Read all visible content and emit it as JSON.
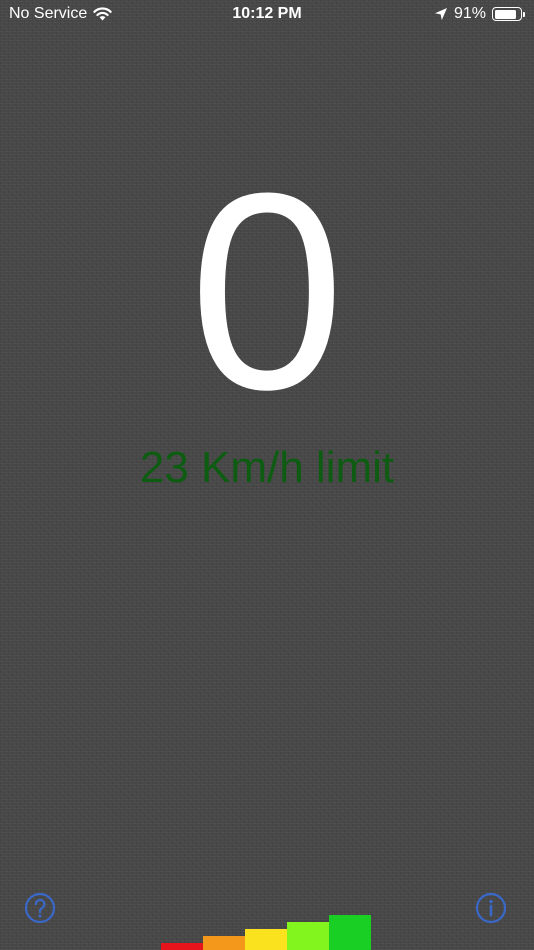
{
  "status_bar": {
    "carrier": "No Service",
    "time": "10:12 PM",
    "battery_percent": "91%",
    "battery_level": 0.91,
    "icons": [
      "wifi-icon",
      "location-arrow-icon",
      "battery-icon"
    ]
  },
  "speedometer": {
    "speed": "0",
    "limit_text": "23 Km/h limit",
    "limit_color": "#0d5c12"
  },
  "controls": {
    "help_icon": "question-mark-circle-icon",
    "info_icon": "info-circle-icon",
    "button_color": "#3a68c9"
  },
  "speed_level_bar": {
    "segments": [
      {
        "color": "#e8141b",
        "level": 0.2
      },
      {
        "color": "#f4981b",
        "level": 0.4
      },
      {
        "color": "#fbe21f",
        "level": 0.6
      },
      {
        "color": "#82f51f",
        "level": 0.8
      },
      {
        "color": "#19cf23",
        "level": 1.0
      }
    ]
  }
}
